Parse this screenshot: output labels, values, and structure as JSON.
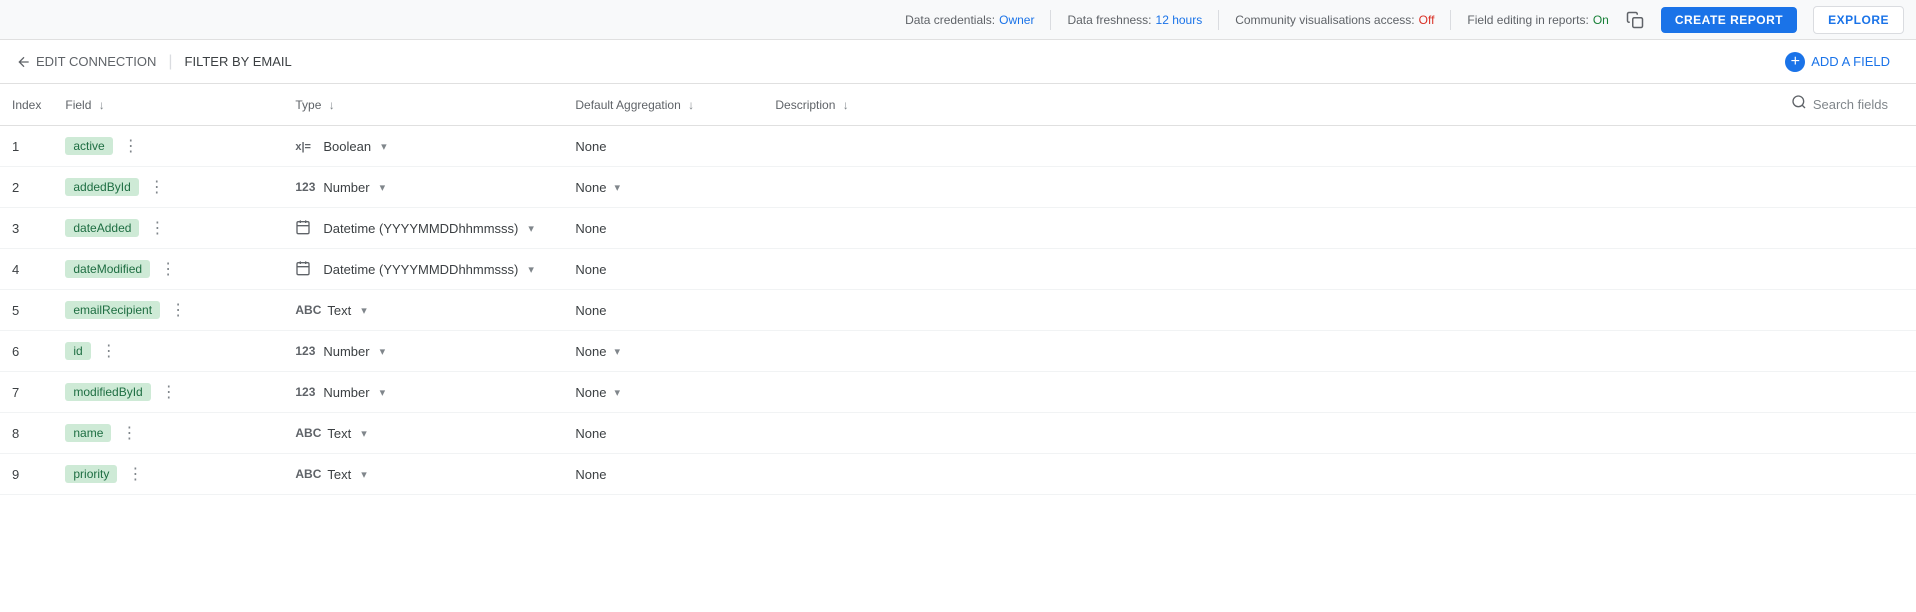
{
  "topBar": {
    "dataCredentials": {
      "label": "Data credentials:",
      "value": "Owner"
    },
    "dataFreshness": {
      "label": "Data freshness:",
      "value": "12 hours"
    },
    "communityAccess": {
      "label": "Community visualisations access:",
      "value": "Off"
    },
    "fieldEditing": {
      "label": "Field editing in reports:",
      "value": "On"
    },
    "createReportLabel": "CREATE REPORT",
    "exploreLabel": "EXPLORE"
  },
  "subBar": {
    "backLabel": "EDIT CONNECTION",
    "separator": "|",
    "filterLabel": "FILTER BY EMAIL",
    "addFieldLabel": "ADD A FIELD"
  },
  "tableHeader": {
    "index": "Index",
    "field": "Field",
    "type": "Type",
    "defaultAggregation": "Default Aggregation",
    "description": "Description",
    "searchPlaceholder": "Search fields"
  },
  "rows": [
    {
      "index": "1",
      "field": "active",
      "typeIcon": "x|=",
      "typeIconLabel": "boolean-icon",
      "type": "Boolean",
      "hasTypeDropdown": true,
      "aggregation": "None",
      "hasAggDropdown": false,
      "description": ""
    },
    {
      "index": "2",
      "field": "addedById",
      "typeIcon": "123",
      "typeIconLabel": "number-icon",
      "type": "Number",
      "hasTypeDropdown": true,
      "aggregation": "None",
      "hasAggDropdown": true,
      "description": ""
    },
    {
      "index": "3",
      "field": "dateAdded",
      "typeIcon": "cal",
      "typeIconLabel": "datetime-icon",
      "type": "Datetime (YYYYMMDDhhmmsss)",
      "hasTypeDropdown": true,
      "aggregation": "None",
      "hasAggDropdown": false,
      "description": ""
    },
    {
      "index": "4",
      "field": "dateModified",
      "typeIcon": "cal",
      "typeIconLabel": "datetime-icon",
      "type": "Datetime (YYYYMMDDhhmmsss)",
      "hasTypeDropdown": true,
      "aggregation": "None",
      "hasAggDropdown": false,
      "description": ""
    },
    {
      "index": "5",
      "field": "emailRecipient",
      "typeIcon": "ABC",
      "typeIconLabel": "text-icon",
      "type": "Text",
      "hasTypeDropdown": true,
      "aggregation": "None",
      "hasAggDropdown": false,
      "description": ""
    },
    {
      "index": "6",
      "field": "id",
      "typeIcon": "123",
      "typeIconLabel": "number-icon",
      "type": "Number",
      "hasTypeDropdown": true,
      "aggregation": "None",
      "hasAggDropdown": true,
      "description": ""
    },
    {
      "index": "7",
      "field": "modifiedById",
      "typeIcon": "123",
      "typeIconLabel": "number-icon",
      "type": "Number",
      "hasTypeDropdown": true,
      "aggregation": "None",
      "hasAggDropdown": true,
      "description": ""
    },
    {
      "index": "8",
      "field": "name",
      "typeIcon": "ABC",
      "typeIconLabel": "text-icon",
      "type": "Text",
      "hasTypeDropdown": true,
      "aggregation": "None",
      "hasAggDropdown": false,
      "description": ""
    },
    {
      "index": "9",
      "field": "priority",
      "typeIcon": "ABC",
      "typeIconLabel": "text-icon",
      "type": "Text",
      "hasTypeDropdown": true,
      "aggregation": "None",
      "hasAggDropdown": false,
      "description": ""
    }
  ]
}
